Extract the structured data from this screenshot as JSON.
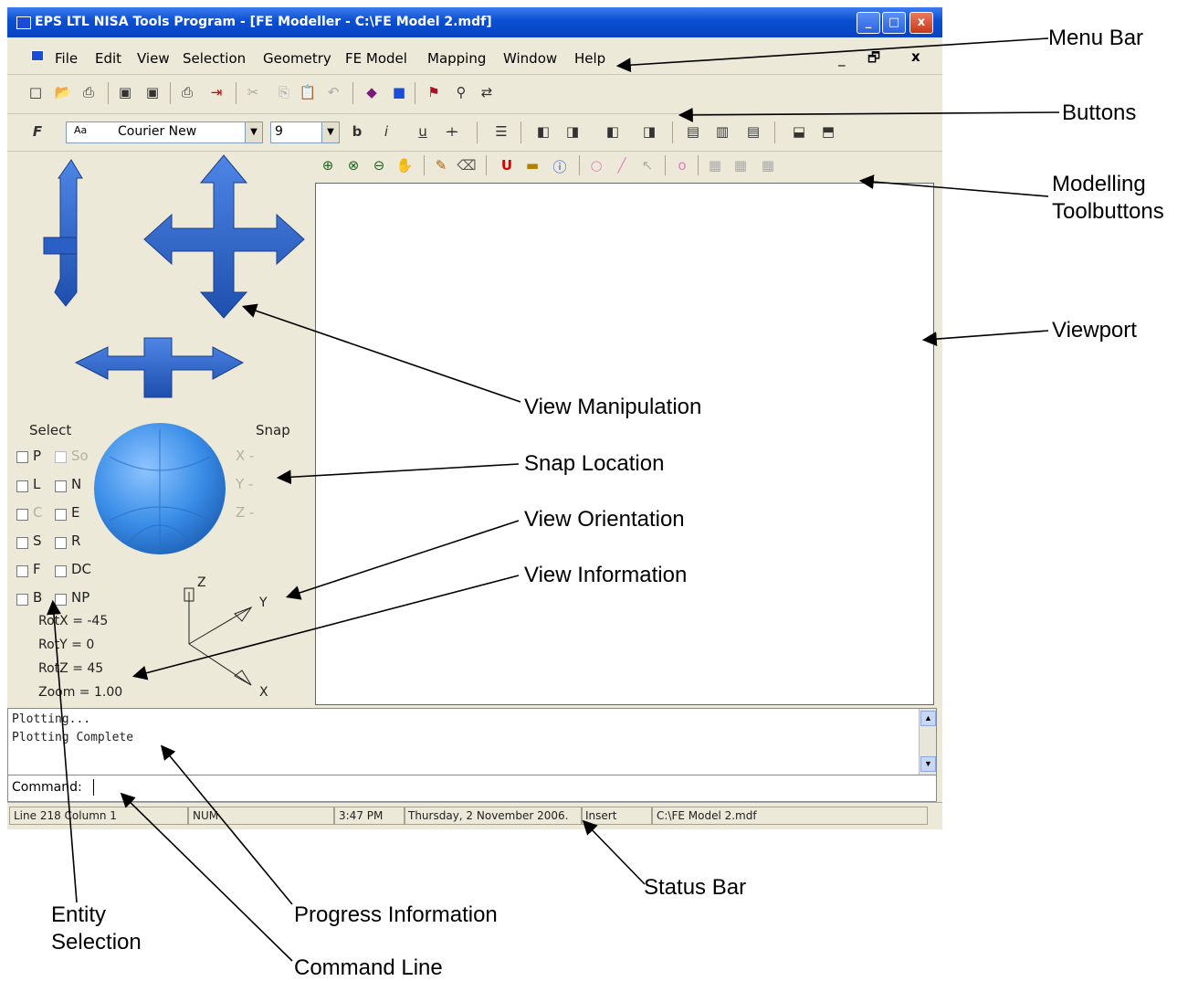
{
  "window": {
    "title": "EPS LTL NISA Tools Program - [FE Modeller - C:\\FE Model 2.mdf]",
    "min": "_",
    "max": "□",
    "close": "x"
  },
  "menu": {
    "items": [
      "File",
      "Edit",
      "View",
      "Selection",
      "Geometry",
      "FE Model",
      "Mapping",
      "Window",
      "Help"
    ],
    "mdi_min": "_",
    "mdi_restore": "🗗",
    "mdi_close": "x"
  },
  "format_toolbar": {
    "font_name": "Courier New",
    "font_size": "9",
    "font_preview": "Aa"
  },
  "left_panel": {
    "select_heading": "Select",
    "snap_heading": "Snap",
    "select_rows": [
      [
        "P",
        "So"
      ],
      [
        "L",
        "N"
      ],
      [
        "C",
        "E"
      ],
      [
        "S",
        "R"
      ],
      [
        "F",
        "DC"
      ],
      [
        "B",
        "NP"
      ]
    ],
    "snap_x": "X -",
    "snap_y": "Y -",
    "snap_z": "Z -",
    "rot_x": "RotX = -45",
    "rot_y": "RotY = 0",
    "rot_z": "RotZ = 45",
    "zoom": "Zoom = 1.00",
    "axis_z": "Z",
    "axis_y": "Y",
    "axis_x": "X"
  },
  "output": {
    "lines": [
      "Plotting...",
      "Plotting Complete"
    ]
  },
  "command": {
    "prompt": "Command:"
  },
  "status": {
    "line_col": "Line 218 Column 1",
    "num": "NUM",
    "time": "3:47 PM",
    "date": "Thursday, 2 November 2006.",
    "mode": "Insert",
    "file": "C:\\FE Model 2.mdf"
  },
  "callouts": {
    "menu_bar": "Menu Bar",
    "buttons": "Buttons",
    "modelling_1": "Modelling",
    "modelling_2": "Toolbuttons",
    "viewport": "Viewport",
    "view_manipulation": "View Manipulation",
    "snap_location": "Snap Location",
    "view_orientation": "View Orientation",
    "view_information": "View Information",
    "status_bar": "Status Bar",
    "entity_1": "Entity",
    "entity_2": "Selection",
    "progress_information": "Progress Information",
    "command_line": "Command Line"
  },
  "colors": {
    "title_blue": "#0a4fd1",
    "arrow_blue": "#2f6bd2",
    "sphere_blue": "#3a8ee8",
    "window_bg": "#ece9d8"
  }
}
